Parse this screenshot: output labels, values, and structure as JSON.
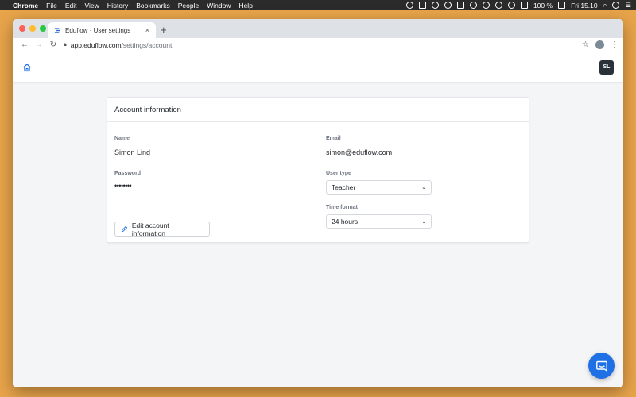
{
  "menubar": {
    "app": "Chrome",
    "items": [
      "File",
      "Edit",
      "View",
      "History",
      "Bookmarks",
      "People",
      "Window",
      "Help"
    ],
    "battery": "100 %",
    "clock": "Fri 15.10"
  },
  "browser": {
    "tab_title": "Eduflow · User settings",
    "url_domain": "app.eduflow.com",
    "url_path": "/settings/account"
  },
  "header": {
    "avatar_initials": "SL"
  },
  "account": {
    "title": "Account information",
    "name_label": "Name",
    "name_value": "Simon Lind",
    "email_label": "Email",
    "email_value": "simon@eduflow.com",
    "password_label": "Password",
    "password_value": "••••••••",
    "user_type_label": "User type",
    "user_type_value": "Teacher",
    "time_format_label": "Time format",
    "time_format_value": "24 hours",
    "edit_button": "Edit account information"
  },
  "colors": {
    "accent": "#1f6fe5",
    "desktop": "#e8a44a",
    "avatar_bg": "#2a3138"
  }
}
